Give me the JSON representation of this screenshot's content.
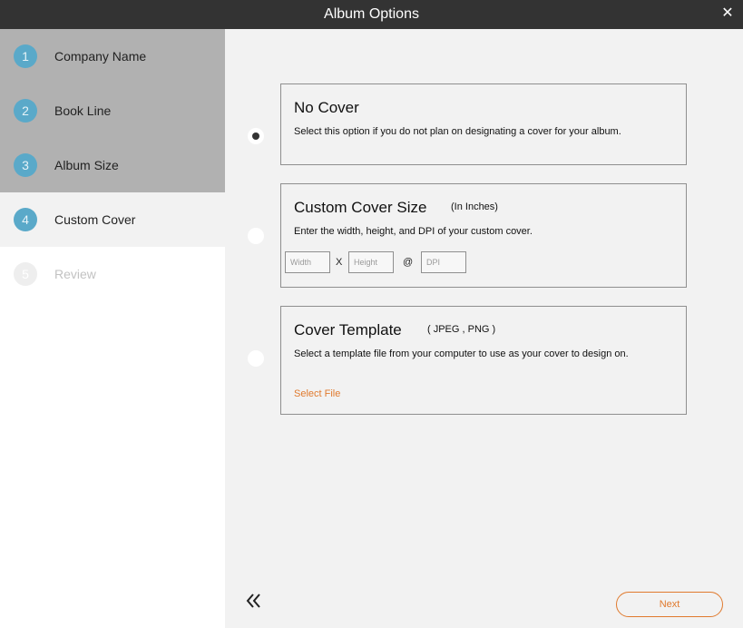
{
  "window": {
    "title": "Album Options",
    "close_icon": "close-icon"
  },
  "steps": [
    {
      "number": "1",
      "label": "Company Name",
      "state": "done"
    },
    {
      "number": "2",
      "label": "Book Line",
      "state": "done"
    },
    {
      "number": "3",
      "label": "Album Size",
      "state": "done"
    },
    {
      "number": "4",
      "label": "Custom Cover",
      "state": "active"
    },
    {
      "number": "5",
      "label": "Review",
      "state": "pending"
    }
  ],
  "options": {
    "selected": "no_cover",
    "no_cover": {
      "title": "No Cover",
      "description": "Select this option if you do not plan on designating a cover for your album."
    },
    "custom_size": {
      "title": "Custom Cover Size",
      "subtitle": "(In Inches)",
      "description": "Enter the width, height, and DPI of your custom cover.",
      "width_placeholder": "Width",
      "height_placeholder": "Height",
      "dpi_placeholder": "DPI",
      "separator_x": "X",
      "separator_at": "@",
      "width_value": "",
      "height_value": "",
      "dpi_value": ""
    },
    "template": {
      "title": "Cover Template",
      "subtitle": "( JPEG , PNG )",
      "description": "Select a template file from your computer to use as your cover to design on.",
      "select_file_label": "Select File"
    }
  },
  "footer": {
    "back_icon": "double-chevron-left-icon",
    "next_label": "Next"
  },
  "colors": {
    "titlebar": "#333333",
    "step_badge": "#5aa9c9",
    "completed_step_bg": "#b1b1b1",
    "accent": "#e07a2e"
  }
}
